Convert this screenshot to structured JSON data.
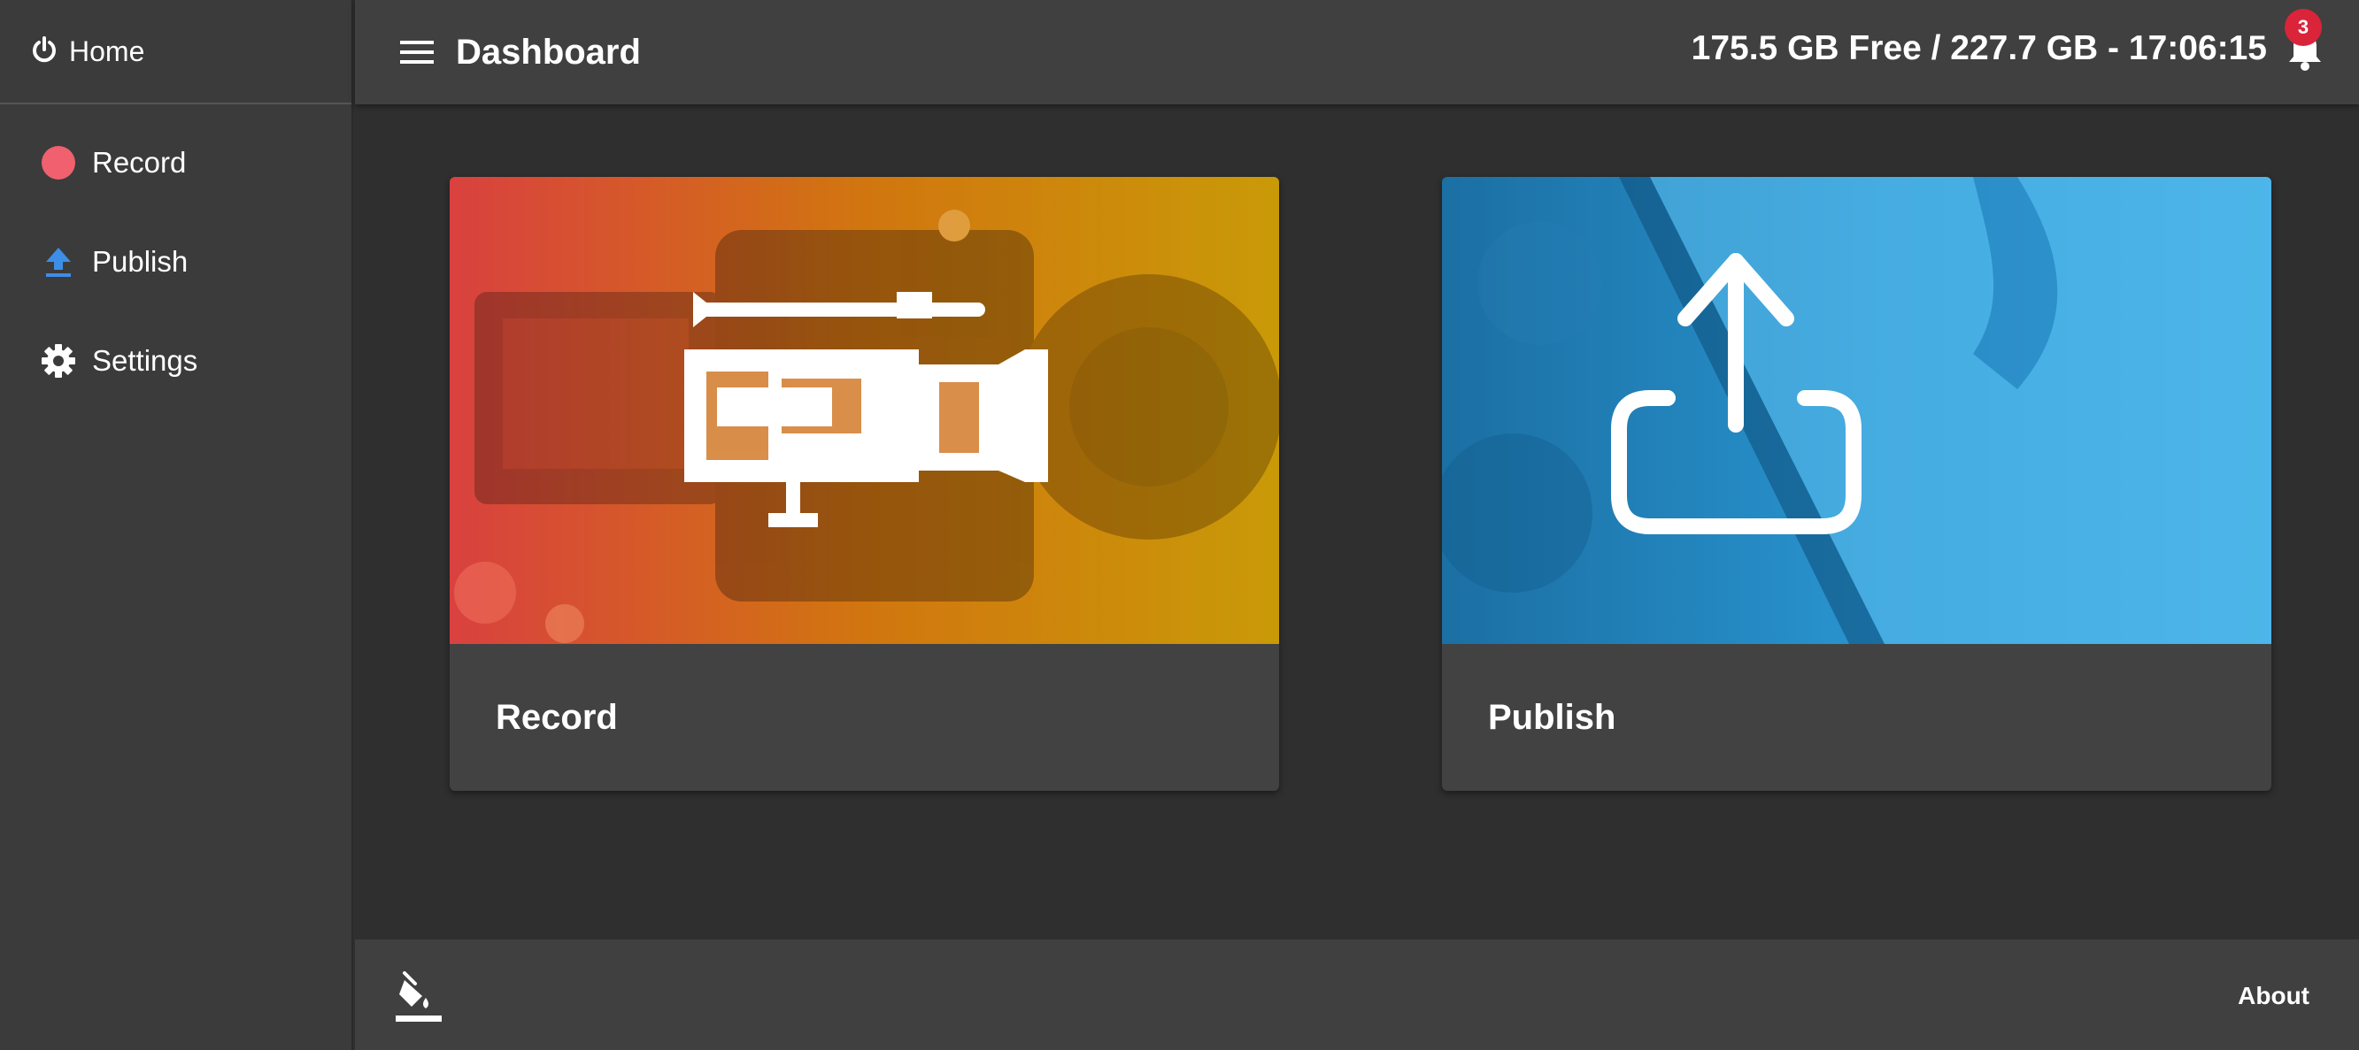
{
  "sidebar": {
    "home": {
      "label": "Home",
      "icon": "power-icon"
    },
    "items": [
      {
        "label": "Record",
        "icon": "record-dot-icon",
        "color": "#f0606e"
      },
      {
        "label": "Publish",
        "icon": "upload-icon",
        "color": "#3d8ee6"
      },
      {
        "label": "Settings",
        "icon": "gear-icon"
      }
    ]
  },
  "header": {
    "title": "Dashboard",
    "status": "175.5 GB Free / 227.7 GB - 17:06:15",
    "notifications": {
      "count": "3",
      "icon": "bell-icon"
    }
  },
  "cards": [
    {
      "label": "Record",
      "icon": "video-camera-icon",
      "gradient": [
        "#d9413f",
        "#d68a0e",
        "#c79a0a"
      ]
    },
    {
      "label": "Publish",
      "icon": "share-upload-icon",
      "gradient": [
        "#1b6fa3",
        "#2a9bd6",
        "#43b4ea"
      ]
    }
  ],
  "footer": {
    "theme_icon": "paint-bucket-icon",
    "about_label": "About"
  },
  "colors": {
    "background": "#2f2f2f",
    "sidebar": "#3b3b3b",
    "header": "#404040",
    "card": "#424242",
    "badge": "#d9243a"
  }
}
